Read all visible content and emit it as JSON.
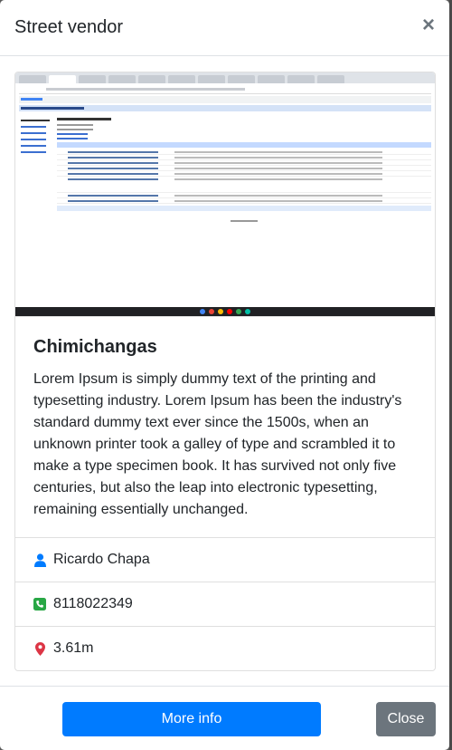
{
  "modal": {
    "title": "Street vendor",
    "close_glyph": "×"
  },
  "card": {
    "image_alt": "Datastore Viewer screenshot",
    "title": "Chimichangas",
    "description": "Lorem Ipsum is simply dummy text of the printing and typesetting industry. Lorem Ipsum has been the industry's standard dummy text ever since the 1500s, when an unknown printer took a galley of type and scrambled it to make a type specimen book. It has survived not only five centuries, but also the leap into electronic typesetting, remaining essentially unchanged."
  },
  "details": {
    "owner": "Ricardo Chapa",
    "phone": "8118022349",
    "distance": "3.61m"
  },
  "icons": {
    "owner": "user-icon",
    "phone": "phone-icon",
    "distance": "map-marker-icon"
  },
  "colors": {
    "user_icon": "#007bff",
    "phone_icon": "#28a745",
    "marker_icon": "#dc3545",
    "primary": "#007bff",
    "secondary": "#6c757d"
  },
  "footer": {
    "more_info_label": "More info",
    "close_label": "Close"
  }
}
